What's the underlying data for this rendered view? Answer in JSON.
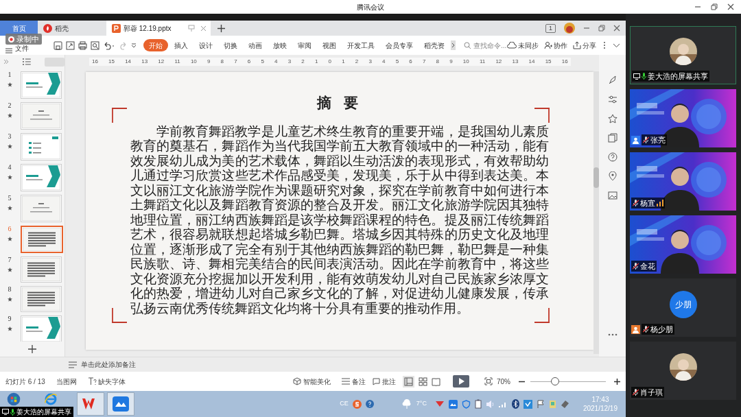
{
  "meeting_window": {
    "title": "腾讯会议"
  },
  "recording_badge": "录制中",
  "wps": {
    "tabs": [
      {
        "label": "首页",
        "kind": "home",
        "selected": false
      },
      {
        "label": "稻壳",
        "kind": "docer",
        "selected": false
      },
      {
        "label": "郭蓉 12.19.pptx",
        "kind": "doc",
        "selected": true
      }
    ],
    "window_badge": "1",
    "file_menu": "文件",
    "ribbon_tabs": [
      {
        "label": "开始",
        "selected": true
      },
      {
        "label": "插入",
        "selected": false
      },
      {
        "label": "设计",
        "selected": false
      },
      {
        "label": "切换",
        "selected": false
      },
      {
        "label": "动画",
        "selected": false
      },
      {
        "label": "放映",
        "selected": false
      },
      {
        "label": "审阅",
        "selected": false
      },
      {
        "label": "视图",
        "selected": false
      },
      {
        "label": "开发工具",
        "selected": false
      },
      {
        "label": "会员专享",
        "selected": false
      },
      {
        "label": "稻壳资",
        "selected": false
      }
    ],
    "search": {
      "placeholder": "查找命令..."
    },
    "actions": [
      {
        "label": "未同步",
        "kind": "sync"
      },
      {
        "label": "协作",
        "kind": "collab"
      },
      {
        "label": "分享",
        "kind": "share"
      }
    ],
    "ruler": [
      "16",
      "15",
      "14",
      "13",
      "12",
      "11",
      "10",
      "9",
      "8",
      "7",
      "6",
      "5",
      "4",
      "3",
      "2",
      "1",
      "0",
      "1",
      "2",
      "3",
      "4",
      "5",
      "6",
      "7",
      "8",
      "9",
      "10",
      "11",
      "12",
      "13",
      "14",
      "15",
      "16"
    ],
    "slides": [
      {
        "number": "1",
        "kind": "cover",
        "selected": false
      },
      {
        "number": "2",
        "kind": "title",
        "selected": false
      },
      {
        "number": "3",
        "kind": "list",
        "selected": false
      },
      {
        "number": "4",
        "kind": "cover",
        "selected": false
      },
      {
        "number": "5",
        "kind": "title",
        "selected": false
      },
      {
        "number": "6",
        "kind": "text",
        "selected": true
      },
      {
        "number": "7",
        "kind": "text",
        "selected": false
      },
      {
        "number": "8",
        "kind": "text",
        "selected": false
      },
      {
        "number": "9",
        "kind": "cover",
        "selected": false
      }
    ],
    "slide": {
      "title": "摘 要",
      "body": "学前教育舞蹈教学是儿童艺术终生教育的重要开端，是我国幼儿素质教育的奠基石，舞蹈作为当代我国学前五大教育领域中的一种活动，能有效发展幼儿成为美的艺术载体，舞蹈以生动活泼的表现形式，有效帮助幼儿通过学习欣赏这些艺术作品感受美，发现美，乐于从中得到表达美。本文以丽江文化旅游学院作为课题研究对象，探究在学前教育中如何进行本土舞蹈文化以及舞蹈教育资源的整合及开发。丽江文化旅游学院因其独特地理位置，丽江纳西族舞蹈是该学校舞蹈课程的特色。提及丽江传统舞蹈艺术，很容易就联想起塔城乡勒巴舞。塔城乡因其特殊的历史文化及地理位置，逐渐形成了完全有别于其他纳西族舞蹈的勒巴舞，勒巴舞是一种集民族歌、诗、舞相完美结合的民间表演活动。因此在学前教育中，将这些文化资源充分挖掘加以开发利用，能有效萌发幼儿对自己民族家乡浓厚文化的热爱，增进幼儿对自己家乡文化的了解，对促进幼儿健康发展，传承弘扬云南优秀传统舞蹈文化均将十分具有重要的推动作用。"
    },
    "notes": {
      "placeholder": "单击此处添加备注"
    },
    "status": {
      "slide_counter": "幻灯片 6 / 13",
      "theme": "当图网",
      "missing_font": "缺失字体",
      "beautify": "智能美化",
      "notes": "备注",
      "comments": "批注",
      "zoom": "70%",
      "zoom_slider": {
        "level": 0.31
      }
    }
  },
  "taskbar": {
    "ime": "CE",
    "weather": "7°C",
    "time": "17:43",
    "date": "2021/12/19"
  },
  "share_caption": "姜大浩的屏幕共享",
  "participants": [
    {
      "name": "姜大浩的屏幕共享",
      "kind": "avatar",
      "sharing": true,
      "speaking": false
    },
    {
      "name": "张亮",
      "kind": "video",
      "sharing": false,
      "speaking": false,
      "color": "#2f7bf0"
    },
    {
      "name": "杨宜",
      "kind": "video",
      "sharing": false,
      "speaking": true
    },
    {
      "name": "金花",
      "kind": "video",
      "sharing": false,
      "speaking": false
    },
    {
      "name": "杨少朋",
      "kind": "initials",
      "initials": "少朋",
      "sharing": false,
      "speaking": false,
      "color": "#e8792e"
    },
    {
      "name": "肖子琪",
      "kind": "avatar",
      "sharing": false,
      "speaking": false
    }
  ]
}
